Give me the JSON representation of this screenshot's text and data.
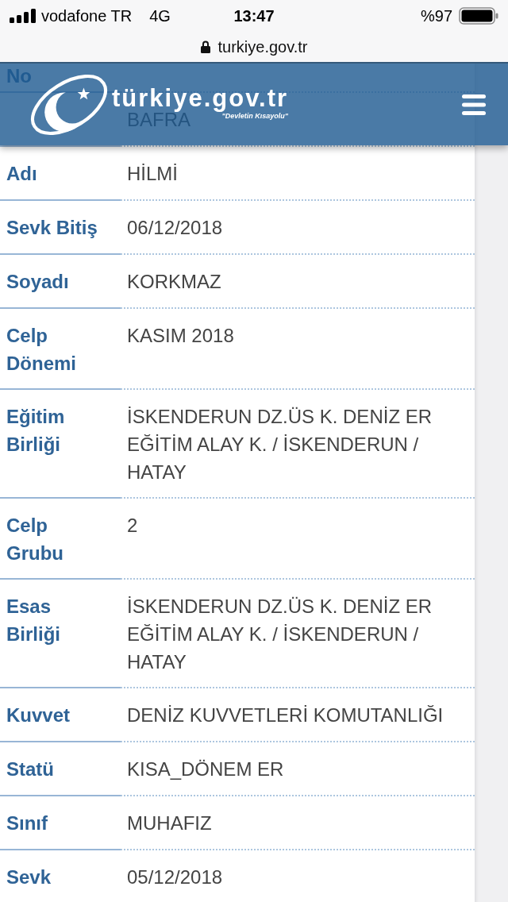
{
  "status_bar": {
    "carrier": "vodafone TR",
    "network": "4G",
    "time": "13:47",
    "battery": "%97"
  },
  "address_bar": {
    "url": "turkiye.gov.tr"
  },
  "header": {
    "logo_text": "türkiye.gov.tr",
    "tagline": "\"Devletin Kısayolu\""
  },
  "details": [
    {
      "label": "No"
    },
    {
      "value": "BAFRA"
    },
    {
      "label": "Adı",
      "value": "HİLMİ"
    },
    {
      "label": "Sevk Bitiş",
      "value": "06/12/2018"
    },
    {
      "label": "Soyadı",
      "value": "KORKMAZ"
    },
    {
      "label": "Celp Dönemi",
      "value": "KASIM 2018"
    },
    {
      "label": "Eğitim Birliği",
      "value": "İSKENDERUN DZ.ÜS K. DENİZ ER EĞİTİM ALAY K. / İSKENDERUN / HATAY"
    },
    {
      "label": "Celp Grubu",
      "value": "2"
    },
    {
      "label": "Esas Birliği",
      "value": "İSKENDERUN DZ.ÜS K. DENİZ ER EĞİTİM ALAY K. / İSKENDERUN / HATAY"
    },
    {
      "label": "Kuvvet",
      "value": "DENİZ KUVVETLERİ KOMUTANLIĞI"
    },
    {
      "label": "Statü",
      "value": "KISA_DÖNEM ER"
    },
    {
      "label": "Sınıf",
      "value": "MUHAFIZ"
    },
    {
      "label": "Sevk",
      "value": "05/12/2018"
    }
  ]
}
